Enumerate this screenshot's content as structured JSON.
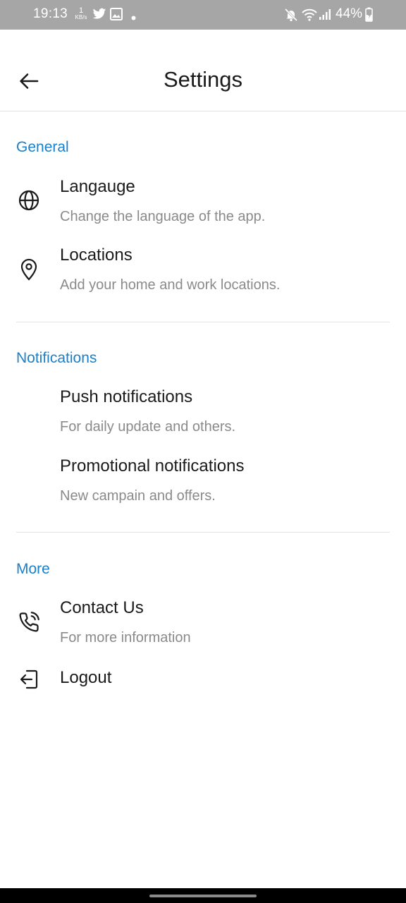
{
  "status_bar": {
    "time": "19:13",
    "net_speed_value": "1",
    "net_speed_unit": "KB/s",
    "battery": "44%",
    "icons": [
      "twitter-icon",
      "image-icon",
      "dot-icon",
      "mute-icon",
      "wifi-icon",
      "signal-icon",
      "battery-charging-icon"
    ]
  },
  "header": {
    "title": "Settings",
    "back_icon": "arrow-left-icon"
  },
  "sections": {
    "general": {
      "title": "General",
      "items": [
        {
          "title": "Langauge",
          "subtitle": "Change the language of the app.",
          "icon": "globe-icon"
        },
        {
          "title": "Locations",
          "subtitle": "Add your home and work locations.",
          "icon": "map-pin-icon"
        }
      ]
    },
    "notifications": {
      "title": "Notifications",
      "items": [
        {
          "title": "Push notifications",
          "subtitle": "For daily update and others."
        },
        {
          "title": "Promotional notifications",
          "subtitle": "New campain and offers."
        }
      ]
    },
    "more": {
      "title": "More",
      "items": [
        {
          "title": "Contact Us",
          "subtitle": "For more information",
          "icon": "phone-call-icon"
        },
        {
          "title": "Logout",
          "icon": "logout-icon"
        }
      ]
    }
  },
  "colors": {
    "accent": "#1a80c9",
    "status_bar": "#a6a6a6",
    "subtitle": "#8a8a8a",
    "divider": "#e3e3e3"
  }
}
